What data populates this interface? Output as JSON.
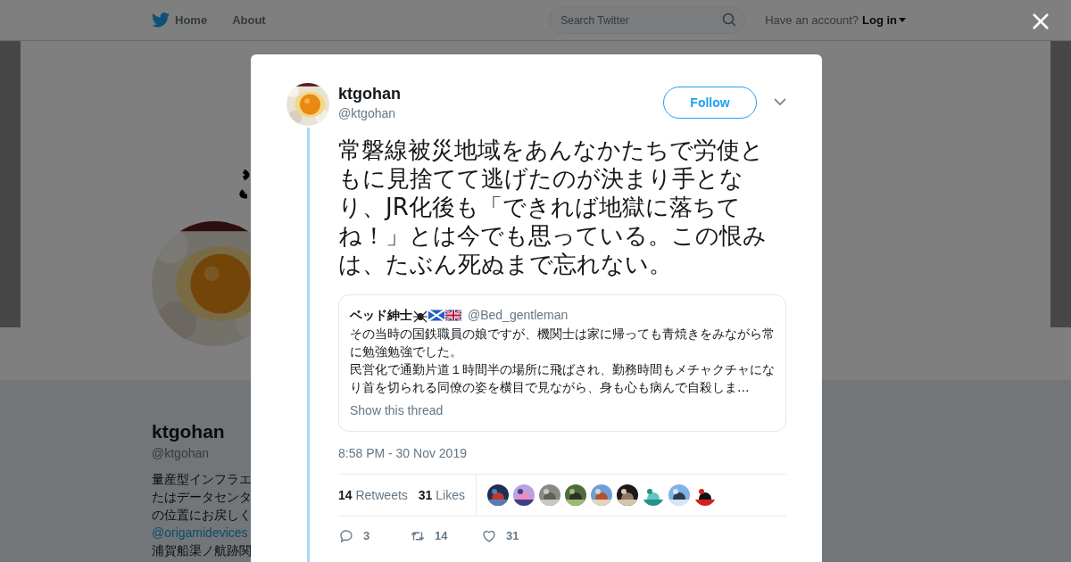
{
  "header": {
    "nav": [
      {
        "label": "Home",
        "kind": "home"
      },
      {
        "label": "About",
        "kind": "text"
      }
    ],
    "search": {
      "placeholder": "Search Twitter"
    },
    "account_prompt": "Have an account?",
    "login": "Log in"
  },
  "profile": {
    "name": "ktgohan",
    "handle": "@ktgohan",
    "bio": [
      {
        "kind": "text",
        "text": "量産型インフラエ"
      },
      {
        "kind": "text",
        "text": "たはデータセンタ"
      },
      {
        "kind": "text",
        "text": "の位置にお戻しく"
      },
      {
        "kind": "link",
        "text": "@origamidevices"
      },
      {
        "kind": "text",
        "text": "浦賀船渠ノ航跡関"
      }
    ]
  },
  "tweet": {
    "author": {
      "name": "ktgohan",
      "handle": "@ktgohan"
    },
    "follow_label": "Follow",
    "text": "常磐線被災地域をあんなかたちで労使ともに見捨てて逃げたのが決まり手となり、JR化後も「できれば地獄に落ちてね！」とは今でも思っている。この恨みは、たぶん死ぬまで忘れない。",
    "quote": {
      "name": "ベッド紳士",
      "handle": "@Bed_gentleman",
      "paragraphs": [
        "その当時の国鉄職員の娘ですが、機関士は家に帰っても青焼きをみながら常に勉強勉強でした。",
        "民営化で通勤片道１時間半の場所に飛ばされ、勤務時間もメチャクチャになり首を切られる同僚の姿を横目で見ながら、身も心も病んで自殺しま…"
      ],
      "link": "Show this thread"
    },
    "timestamp": "8:58 PM - 30 Nov 2019",
    "stats": [
      {
        "count": "14",
        "label": "Retweets"
      },
      {
        "count": "31",
        "label": "Likes"
      }
    ],
    "actions": [
      {
        "kind": "reply",
        "count": "3"
      },
      {
        "kind": "retweet",
        "count": "14"
      },
      {
        "kind": "like",
        "count": "31"
      }
    ]
  }
}
